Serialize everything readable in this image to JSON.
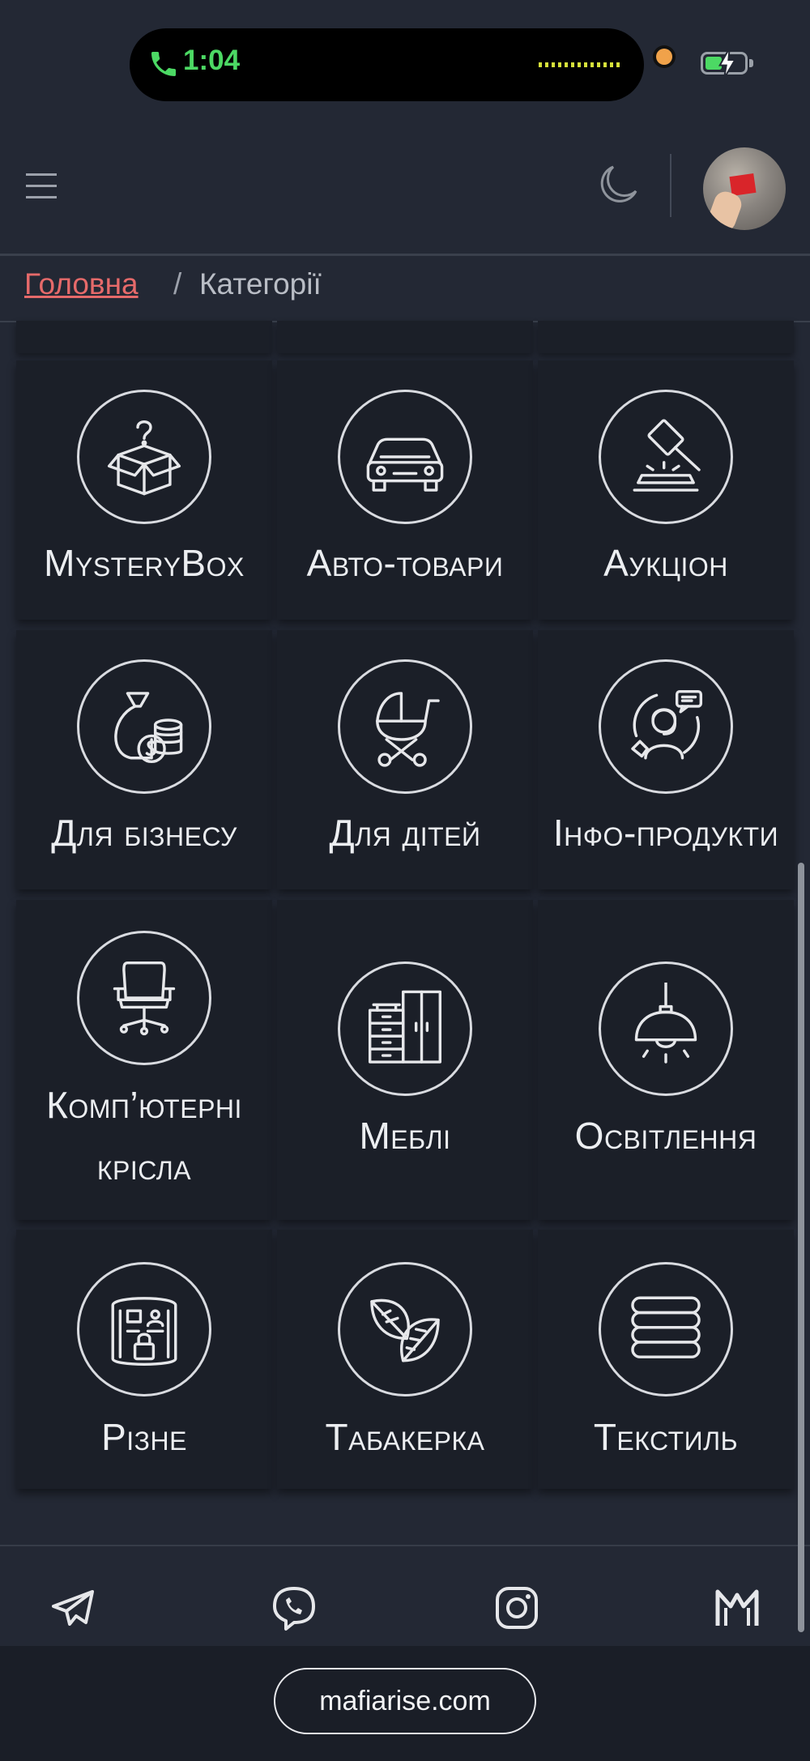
{
  "status": {
    "time": "1:04"
  },
  "breadcrumb": {
    "home": "Головна",
    "separator": "/",
    "current": "Категорії"
  },
  "categories": [
    {
      "label": "MysteryBox",
      "icon": "mystery-box-icon"
    },
    {
      "label": "Авто-товари",
      "icon": "car-icon"
    },
    {
      "label": "Аукціон",
      "icon": "auction-gavel-icon"
    },
    {
      "label": "Для бізнесу",
      "icon": "money-bag-icon"
    },
    {
      "label": "Для дітей",
      "icon": "baby-stroller-icon"
    },
    {
      "label": "Інфо-продукти",
      "icon": "support-agent-icon"
    },
    {
      "label": "Комп’ютерні",
      "label2": "крісла",
      "icon": "office-chair-icon"
    },
    {
      "label": "Меблі",
      "icon": "furniture-icon"
    },
    {
      "label": "Освітлення",
      "icon": "lamp-icon"
    },
    {
      "label": "Різне",
      "icon": "misc-icon"
    },
    {
      "label": "Табакерка",
      "icon": "tobacco-leaf-icon"
    },
    {
      "label": "Текстиль",
      "icon": "textile-stack-icon"
    }
  ],
  "footer": {
    "social": [
      "telegram-icon",
      "viber-icon",
      "instagram-icon",
      "mafia-m-icon"
    ],
    "site": "mafiarise.com"
  },
  "colors": {
    "background": "#232834",
    "tile": "#1b1f28",
    "link": "#e66a6a",
    "call_green": "#4cd964"
  }
}
